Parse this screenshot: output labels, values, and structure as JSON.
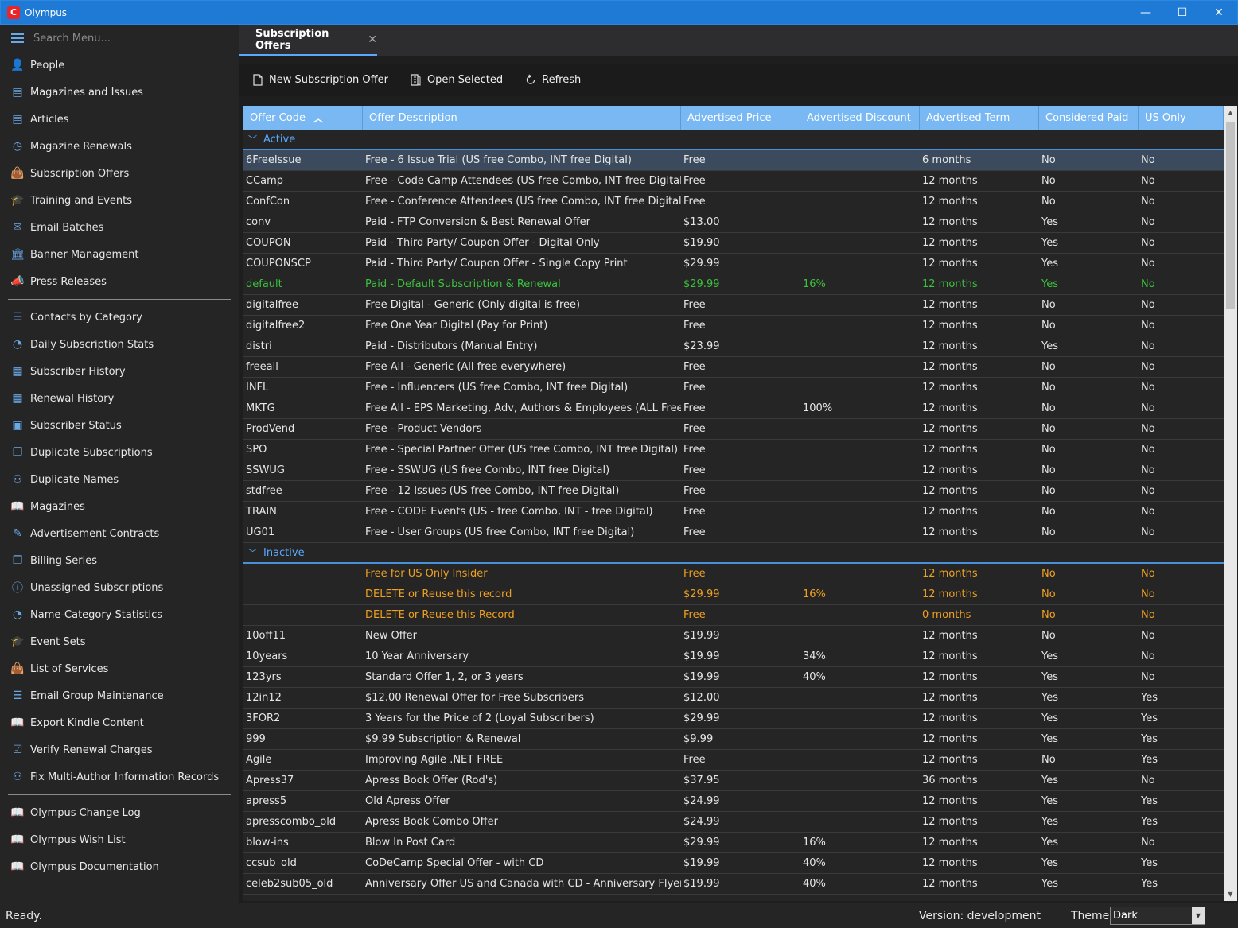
{
  "app": {
    "title": "Olympus",
    "logo_letter": "C"
  },
  "window": {
    "minimize": "—",
    "maximize": "☐",
    "close": "✕"
  },
  "sidebar": {
    "search_placeholder": "Search Menu...",
    "group1": [
      {
        "label": "People",
        "icon": "person-icon"
      },
      {
        "label": "Magazines and Issues",
        "icon": "magazine-icon"
      },
      {
        "label": "Articles",
        "icon": "article-icon"
      },
      {
        "label": "Magazine Renewals",
        "icon": "clock-icon"
      },
      {
        "label": "Subscription Offers",
        "icon": "bag-icon"
      },
      {
        "label": "Training and Events",
        "icon": "graduation-icon"
      },
      {
        "label": "Email Batches",
        "icon": "envelope-icon"
      },
      {
        "label": "Banner Management",
        "icon": "bank-icon"
      },
      {
        "label": "Press Releases",
        "icon": "megaphone-icon"
      }
    ],
    "group2": [
      {
        "label": "Contacts by Category",
        "icon": "contacts-icon"
      },
      {
        "label": "Daily Subscription Stats",
        "icon": "pie-icon"
      },
      {
        "label": "Subscriber History",
        "icon": "calendar-icon"
      },
      {
        "label": "Renewal History",
        "icon": "calendar-icon"
      },
      {
        "label": "Subscriber Status",
        "icon": "status-icon"
      },
      {
        "label": "Duplicate Subscriptions",
        "icon": "copy-icon"
      },
      {
        "label": "Duplicate Names",
        "icon": "people-icon"
      },
      {
        "label": "Magazines",
        "icon": "book-icon"
      },
      {
        "label": "Advertisement Contracts",
        "icon": "contract-icon"
      },
      {
        "label": "Billing Series",
        "icon": "copy-icon"
      },
      {
        "label": "Unassigned Subscriptions",
        "icon": "info-icon"
      },
      {
        "label": "Name-Category Statistics",
        "icon": "pie-icon"
      },
      {
        "label": "Event Sets",
        "icon": "graduation-icon"
      },
      {
        "label": "List of Services",
        "icon": "bag-icon"
      },
      {
        "label": "Email Group Maintenance",
        "icon": "contacts-icon"
      },
      {
        "label": "Export Kindle Content",
        "icon": "book-icon"
      },
      {
        "label": "Verify Renewal Charges",
        "icon": "checklist-icon"
      },
      {
        "label": "Fix Multi-Author Information Records",
        "icon": "people-icon"
      }
    ],
    "group3": [
      {
        "label": "Olympus Change Log",
        "icon": "book-icon"
      },
      {
        "label": "Olympus Wish List",
        "icon": "book-icon"
      },
      {
        "label": "Olympus Documentation",
        "icon": "book-icon"
      }
    ]
  },
  "tab": {
    "label": "Subscription Offers",
    "close": "✕"
  },
  "toolbar": {
    "new_label": "New Subscription Offer",
    "open_label": "Open Selected",
    "refresh_label": "Refresh"
  },
  "grid": {
    "columns": [
      "Offer Code",
      "Offer Description",
      "Advertised Price",
      "Advertised Discount",
      "Advertised Term",
      "Considered Paid",
      "US Only"
    ],
    "groups": [
      {
        "name": "Active",
        "rows": [
          {
            "code": "6FreeIssue",
            "desc": "Free -  6 Issue Trial (US free Combo, INT free Digital)",
            "price": "Free",
            "discount": "",
            "term": "6 months",
            "paid": "No",
            "us": "No",
            "style": "selected"
          },
          {
            "code": "CCamp",
            "desc": "Free - Code Camp Attendees (US free Combo, INT free Digital)",
            "price": "Free",
            "discount": "",
            "term": "12 months",
            "paid": "No",
            "us": "No",
            "style": ""
          },
          {
            "code": "ConfCon",
            "desc": "Free - Conference Attendees (US free Combo, INT free Digital)",
            "price": "Free",
            "discount": "",
            "term": "12 months",
            "paid": "No",
            "us": "No",
            "style": ""
          },
          {
            "code": "conv",
            "desc": "Paid - FTP Conversion & Best Renewal Offer",
            "price": "$13.00",
            "discount": "",
            "term": "12 months",
            "paid": "Yes",
            "us": "No",
            "style": ""
          },
          {
            "code": "COUPON",
            "desc": "Paid - Third Party/ Coupon Offer - Digital Only",
            "price": "$19.90",
            "discount": "",
            "term": "12 months",
            "paid": "Yes",
            "us": "No",
            "style": ""
          },
          {
            "code": "COUPONSCP",
            "desc": "Paid - Third Party/ Coupon Offer - Single Copy Print",
            "price": "$29.99",
            "discount": "",
            "term": "12 months",
            "paid": "Yes",
            "us": "No",
            "style": ""
          },
          {
            "code": "default",
            "desc": "Paid - Default Subscription & Renewal",
            "price": "$29.99",
            "discount": "16%",
            "term": "12 months",
            "paid": "Yes",
            "us": "No",
            "style": "green"
          },
          {
            "code": "digitalfree",
            "desc": "Free Digital - Generic (Only digital is free)",
            "price": "Free",
            "discount": "",
            "term": "12 months",
            "paid": "No",
            "us": "No",
            "style": ""
          },
          {
            "code": "digitalfree2",
            "desc": "Free One Year Digital (Pay for Print)",
            "price": "Free",
            "discount": "",
            "term": "12 months",
            "paid": "No",
            "us": "No",
            "style": ""
          },
          {
            "code": "distri",
            "desc": "Paid - Distributors (Manual Entry)",
            "price": "$23.99",
            "discount": "",
            "term": "12 months",
            "paid": "Yes",
            "us": "No",
            "style": ""
          },
          {
            "code": "freeall",
            "desc": "Free All - Generic (All free everywhere)",
            "price": "Free",
            "discount": "",
            "term": "12 months",
            "paid": "No",
            "us": "No",
            "style": ""
          },
          {
            "code": "INFL",
            "desc": "Free - Influencers (US free Combo, INT free Digital)",
            "price": "Free",
            "discount": "",
            "term": "12 months",
            "paid": "No",
            "us": "No",
            "style": ""
          },
          {
            "code": "MKTG",
            "desc": "Free All - EPS Marketing, Adv, Authors & Employees (ALL Free E...",
            "price": "Free",
            "discount": "100%",
            "term": "12 months",
            "paid": "No",
            "us": "No",
            "style": ""
          },
          {
            "code": "ProdVend",
            "desc": "Free - Product Vendors",
            "price": "Free",
            "discount": "",
            "term": "12 months",
            "paid": "No",
            "us": "No",
            "style": ""
          },
          {
            "code": "SPO",
            "desc": "Free - Special Partner Offer (US free Combo, INT free Digital)",
            "price": "Free",
            "discount": "",
            "term": "12 months",
            "paid": "No",
            "us": "No",
            "style": ""
          },
          {
            "code": "SSWUG",
            "desc": "Free - SSWUG (US free Combo, INT free Digital)",
            "price": "Free",
            "discount": "",
            "term": "12 months",
            "paid": "No",
            "us": "No",
            "style": ""
          },
          {
            "code": "stdfree",
            "desc": "Free - 12 Issues (US free Combo, INT free Digital)",
            "price": "Free",
            "discount": "",
            "term": "12 months",
            "paid": "No",
            "us": "No",
            "style": ""
          },
          {
            "code": "TRAIN",
            "desc": "Free - CODE Events (US - free Combo, INT - free Digital)",
            "price": "Free",
            "discount": "",
            "term": "12 months",
            "paid": "No",
            "us": "No",
            "style": ""
          },
          {
            "code": "UG01",
            "desc": "Free - User Groups (US free Combo, INT free Digital)",
            "price": "Free",
            "discount": "",
            "term": "12 months",
            "paid": "No",
            "us": "No",
            "style": ""
          }
        ]
      },
      {
        "name": "Inactive",
        "rows": [
          {
            "code": "",
            "desc": "Free for US Only Insider",
            "price": "Free",
            "discount": "",
            "term": "12 months",
            "paid": "No",
            "us": "No",
            "style": "orange"
          },
          {
            "code": "",
            "desc": "DELETE or Reuse this record",
            "price": "$29.99",
            "discount": "16%",
            "term": "12 months",
            "paid": "No",
            "us": "No",
            "style": "orange"
          },
          {
            "code": "",
            "desc": "DELETE or Reuse this Record",
            "price": "Free",
            "discount": "",
            "term": "0 months",
            "paid": "No",
            "us": "No",
            "style": "orange"
          },
          {
            "code": "10off11",
            "desc": "New Offer",
            "price": "$19.99",
            "discount": "",
            "term": "12 months",
            "paid": "No",
            "us": "No",
            "style": ""
          },
          {
            "code": "10years",
            "desc": "10 Year Anniversary",
            "price": "$19.99",
            "discount": "34%",
            "term": "12 months",
            "paid": "Yes",
            "us": "No",
            "style": ""
          },
          {
            "code": "123yrs",
            "desc": "Standard Offer 1, 2, or 3 years",
            "price": "$19.99",
            "discount": "40%",
            "term": "12 months",
            "paid": "Yes",
            "us": "No",
            "style": ""
          },
          {
            "code": "12in12",
            "desc": "$12.00 Renewal Offer for Free Subscribers",
            "price": "$12.00",
            "discount": "",
            "term": "12 months",
            "paid": "Yes",
            "us": "Yes",
            "style": ""
          },
          {
            "code": "3FOR2",
            "desc": "3 Years for the Price of 2 (Loyal Subscribers)",
            "price": "$29.99",
            "discount": "",
            "term": "12 months",
            "paid": "Yes",
            "us": "Yes",
            "style": ""
          },
          {
            "code": "999",
            "desc": "$9.99 Subscription & Renewal",
            "price": "$9.99",
            "discount": "",
            "term": "12 months",
            "paid": "Yes",
            "us": "Yes",
            "style": ""
          },
          {
            "code": "Agile",
            "desc": "Improving Agile .NET FREE",
            "price": "Free",
            "discount": "",
            "term": "12 months",
            "paid": "No",
            "us": "Yes",
            "style": ""
          },
          {
            "code": "Apress37",
            "desc": "Apress Book Offer (Rod's)",
            "price": "$37.95",
            "discount": "",
            "term": "36 months",
            "paid": "Yes",
            "us": "No",
            "style": ""
          },
          {
            "code": "apress5",
            "desc": "Old Apress Offer",
            "price": "$24.99",
            "discount": "",
            "term": "12 months",
            "paid": "Yes",
            "us": "Yes",
            "style": ""
          },
          {
            "code": "apresscombo_old",
            "desc": "Apress Book Combo Offer",
            "price": "$24.99",
            "discount": "",
            "term": "12 months",
            "paid": "Yes",
            "us": "Yes",
            "style": ""
          },
          {
            "code": "blow-ins",
            "desc": "Blow In Post Card",
            "price": "$29.99",
            "discount": "16%",
            "term": "12 months",
            "paid": "Yes",
            "us": "No",
            "style": ""
          },
          {
            "code": "ccsub_old",
            "desc": "CoDeCamp Special Offer - with CD",
            "price": "$19.99",
            "discount": "40%",
            "term": "12 months",
            "paid": "Yes",
            "us": "Yes",
            "style": ""
          },
          {
            "code": "celeb2sub05_old",
            "desc": "Anniversary Offer US and Canada with CD - Anniversary Flyer",
            "price": "$19.99",
            "discount": "40%",
            "term": "12 months",
            "paid": "Yes",
            "us": "Yes",
            "style": ""
          }
        ]
      }
    ]
  },
  "colors": {
    "accent": "#5aa7ff",
    "header": "#79b8f2",
    "green": "#3cc13c",
    "orange": "#f0a020",
    "titlebar": "#1f7ad6"
  },
  "status": {
    "text": "Ready.",
    "version": "Version: development",
    "theme_label": "Theme:",
    "theme_value": "Dark"
  }
}
